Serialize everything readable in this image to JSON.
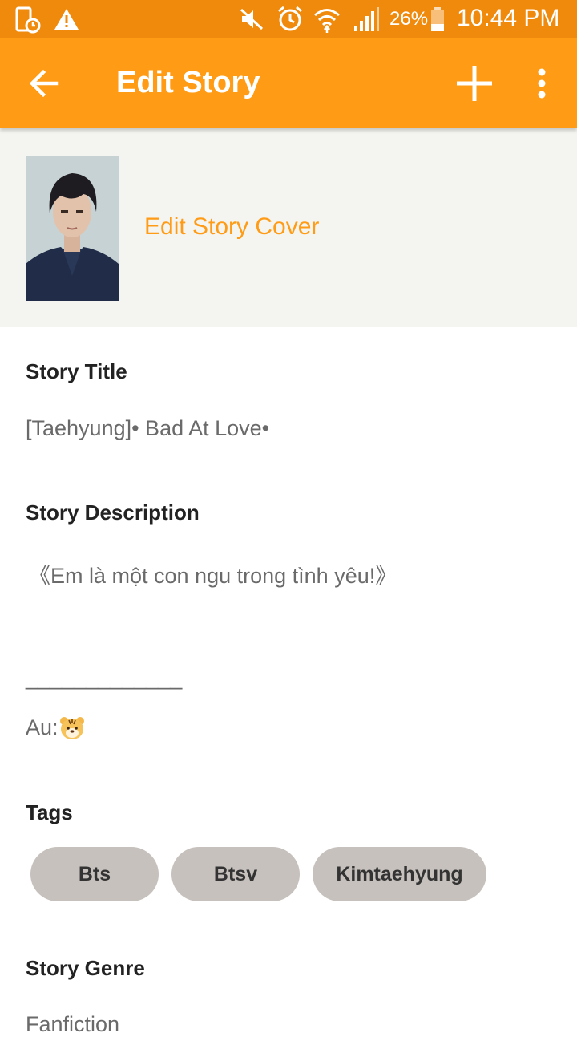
{
  "status_bar": {
    "icons": [
      "tablet-sync-icon",
      "warning-icon",
      "mute-icon",
      "alarm-icon",
      "wifi-icon",
      "signal-icon",
      "battery-icon"
    ],
    "battery": "26%",
    "time": "10:44 PM",
    "color": "#f08a0c"
  },
  "app_bar": {
    "title": "Edit Story",
    "color": "#ff9b14",
    "icons": [
      "back-arrow-icon",
      "plus-icon",
      "more-vert-icon"
    ]
  },
  "cover": {
    "edit_label": "Edit Story Cover"
  },
  "story_title": {
    "label": "Story Title",
    "value": "[Taehyung]• Bad At Love•"
  },
  "story_description": {
    "label": "Story Description",
    "line1": "《Em là một con ngu trong tình yêu!》",
    "divider": "_____________",
    "author_prefix": "Au:",
    "author_emoji_icon": "tiger-face-icon"
  },
  "tags": {
    "label": "Tags",
    "items": [
      "Bts",
      "Btsv",
      "Kimtaehyung"
    ]
  },
  "genre": {
    "label": "Story Genre",
    "value": "Fanfiction"
  }
}
